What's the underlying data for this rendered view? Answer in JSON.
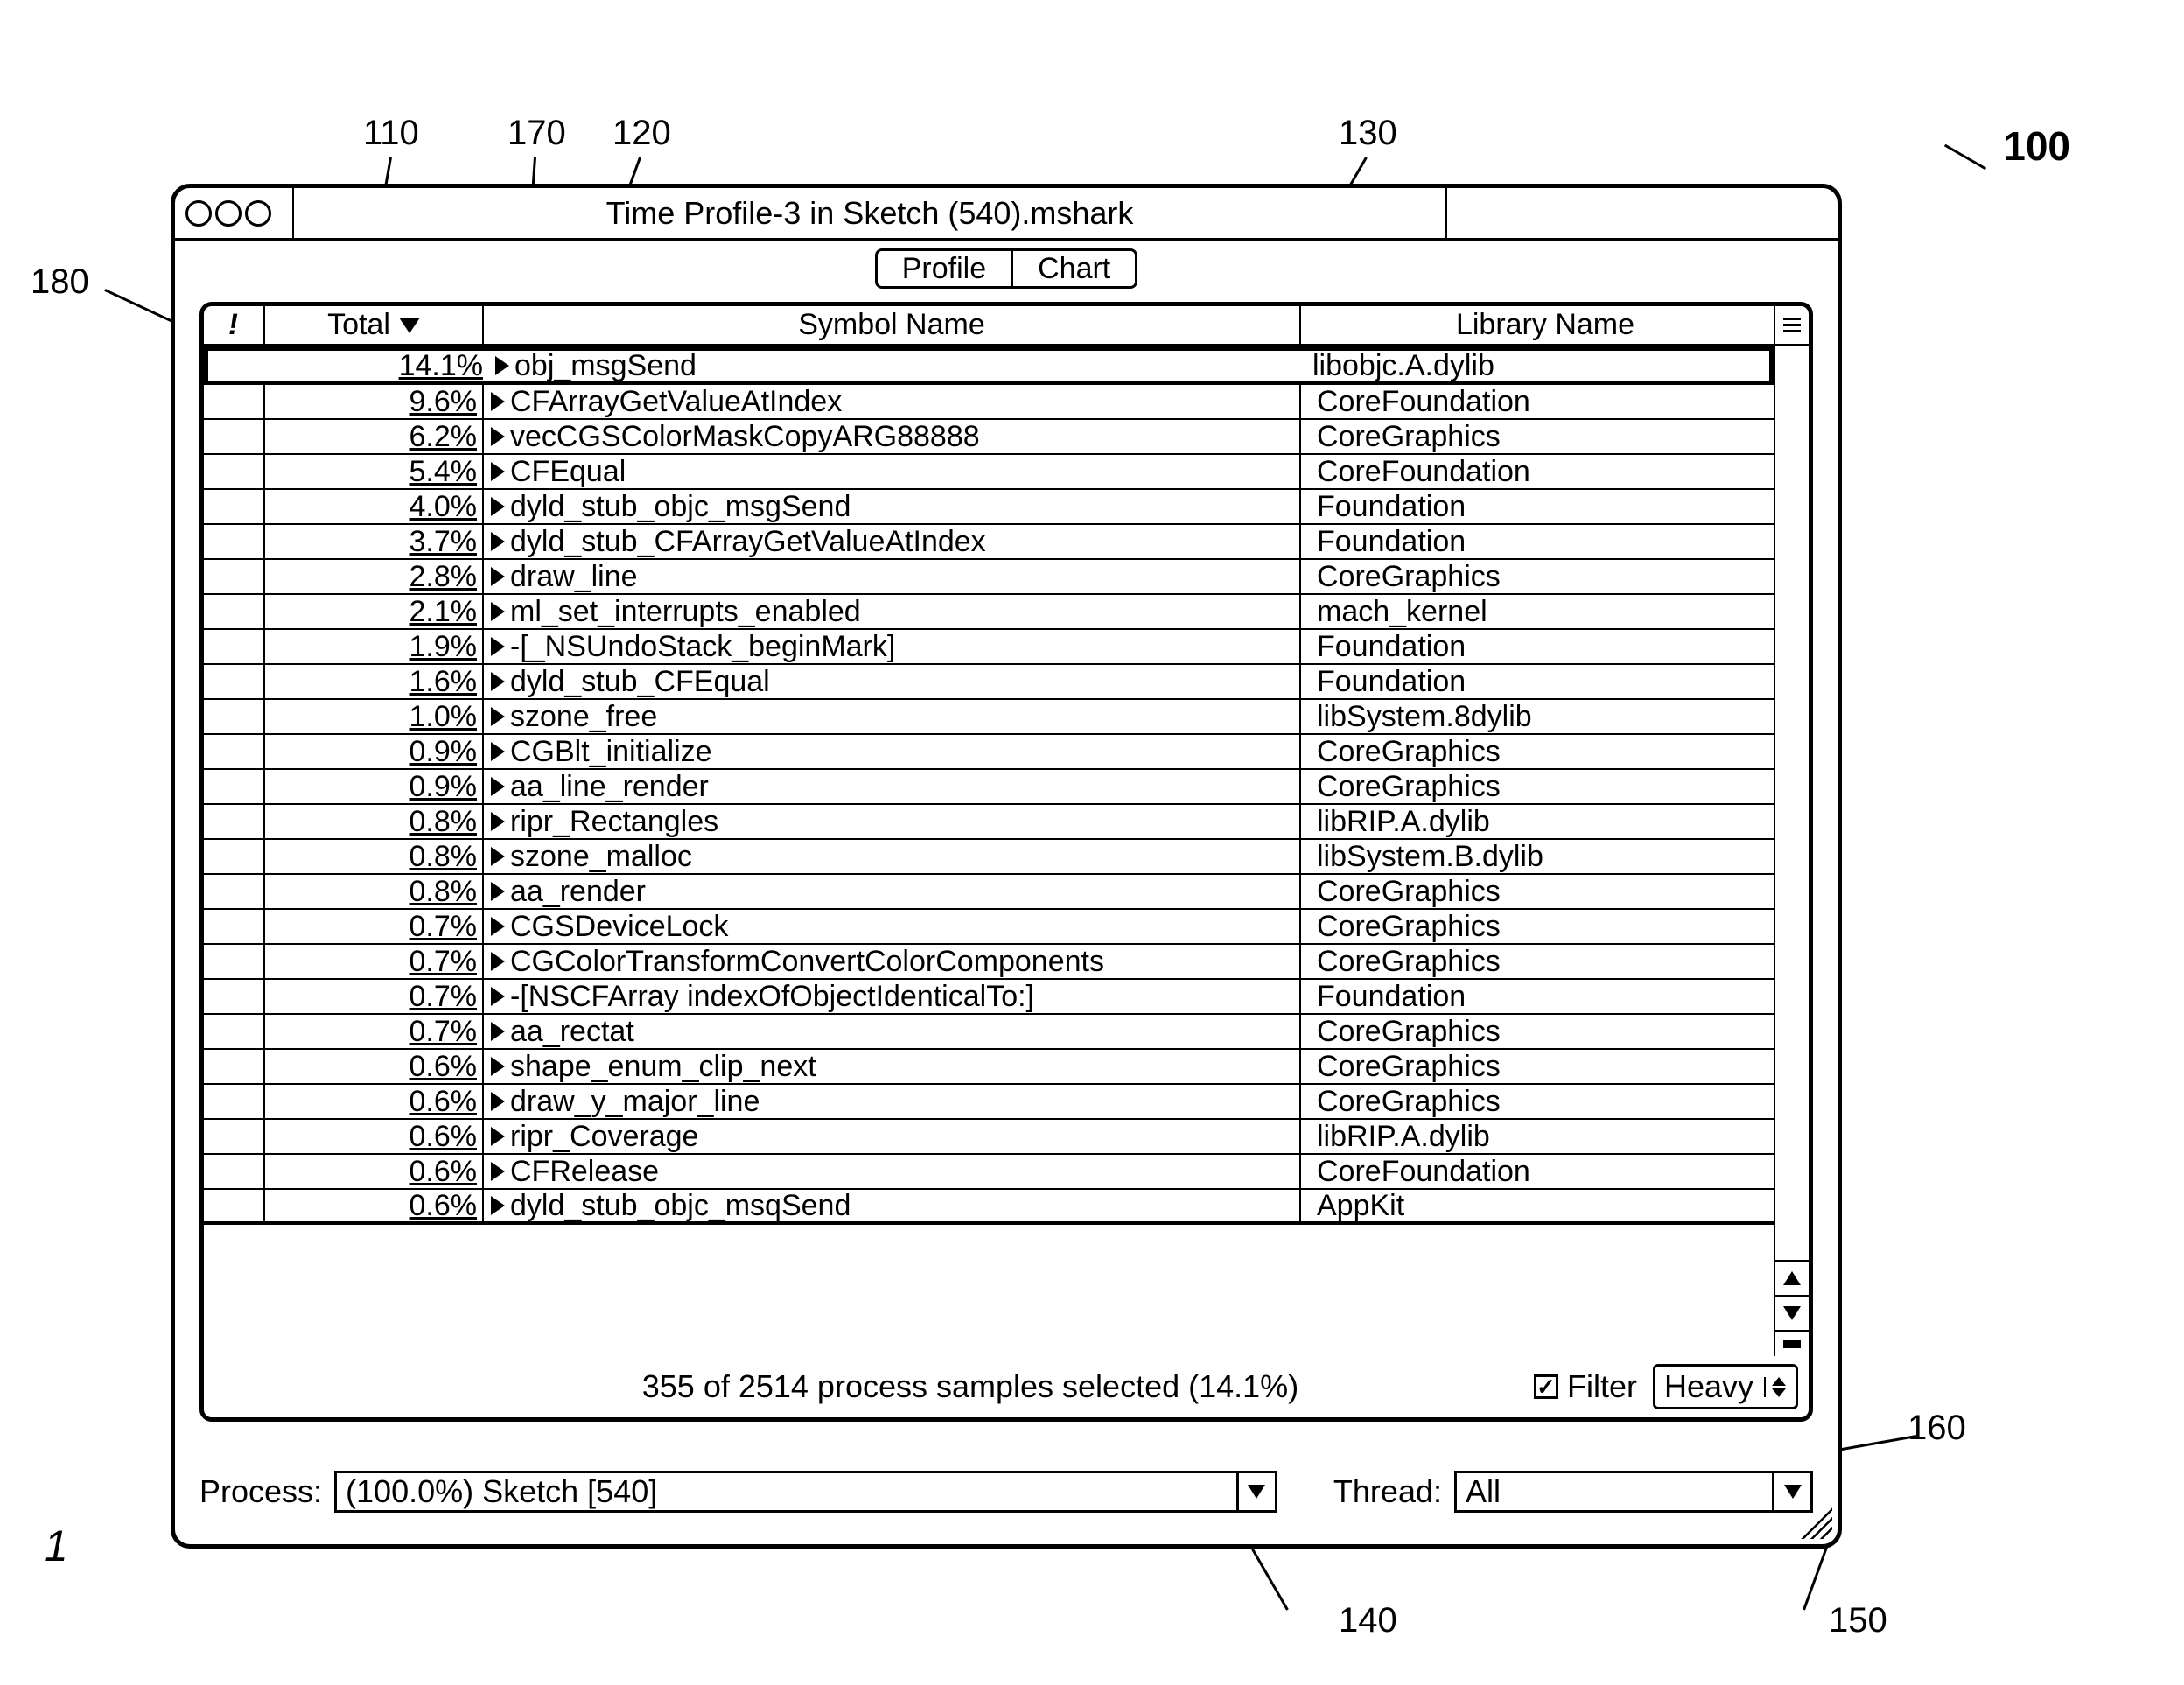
{
  "figure_label": "1",
  "figure_ref": "100",
  "callouts": {
    "c100": "100",
    "c110": "110",
    "c120": "120",
    "c130": "130",
    "c140": "140",
    "c150": "150",
    "c160": "160",
    "c170": "170",
    "c180": "180"
  },
  "window": {
    "title": "Time Profile-3 in Sketch (540).mshark"
  },
  "tabs": {
    "profile": "Profile",
    "chart": "Chart"
  },
  "columns": {
    "alert": "!",
    "total": "Total",
    "symbol": "Symbol Name",
    "library": "Library Name"
  },
  "rows": [
    {
      "total": "14.1%",
      "symbol": "obj_msgSend",
      "lib": "libobjc.A.dylib"
    },
    {
      "total": "9.6%",
      "symbol": "CFArrayGetValueAtIndex",
      "lib": "CoreFoundation"
    },
    {
      "total": "6.2%",
      "symbol": "vecCGSColorMaskCopyARG88888",
      "lib": "CoreGraphics"
    },
    {
      "total": "5.4%",
      "symbol": "CFEqual",
      "lib": "CoreFoundation"
    },
    {
      "total": "4.0%",
      "symbol": "dyld_stub_objc_msgSend",
      "lib": "Foundation"
    },
    {
      "total": "3.7%",
      "symbol": "dyld_stub_CFArrayGetValueAtIndex",
      "lib": "Foundation"
    },
    {
      "total": "2.8%",
      "symbol": "draw_line",
      "lib": "CoreGraphics"
    },
    {
      "total": "2.1%",
      "symbol": "ml_set_interrupts_enabled",
      "lib": "mach_kernel"
    },
    {
      "total": "1.9%",
      "symbol": "-[_NSUndoStack_beginMark]",
      "lib": "Foundation"
    },
    {
      "total": "1.6%",
      "symbol": "dyld_stub_CFEqual",
      "lib": "Foundation"
    },
    {
      "total": "1.0%",
      "symbol": "szone_free",
      "lib": "libSystem.8dylib"
    },
    {
      "total": "0.9%",
      "symbol": "CGBlt_initialize",
      "lib": "CoreGraphics"
    },
    {
      "total": "0.9%",
      "symbol": "aa_line_render",
      "lib": "CoreGraphics"
    },
    {
      "total": "0.8%",
      "symbol": "ripr_Rectangles",
      "lib": "libRIP.A.dylib"
    },
    {
      "total": "0.8%",
      "symbol": "szone_malloc",
      "lib": "libSystem.B.dylib"
    },
    {
      "total": "0.8%",
      "symbol": "aa_render",
      "lib": "CoreGraphics"
    },
    {
      "total": "0.7%",
      "symbol": "CGSDeviceLock",
      "lib": "CoreGraphics"
    },
    {
      "total": "0.7%",
      "symbol": "CGColorTransformConvertColorComponents",
      "lib": "CoreGraphics"
    },
    {
      "total": "0.7%",
      "symbol": "-[NSCFArray indexOfObjectIdenticalTo:]",
      "lib": "Foundation"
    },
    {
      "total": "0.7%",
      "symbol": "aa_rectat",
      "lib": "CoreGraphics"
    },
    {
      "total": "0.6%",
      "symbol": "shape_enum_clip_next",
      "lib": "CoreGraphics"
    },
    {
      "total": "0.6%",
      "symbol": "draw_y_major_line",
      "lib": "CoreGraphics"
    },
    {
      "total": "0.6%",
      "symbol": "ripr_Coverage",
      "lib": "libRIP.A.dylib"
    },
    {
      "total": "0.6%",
      "symbol": " CFRelease",
      "lib": "CoreFoundation"
    },
    {
      "total": "0.6%",
      "symbol": "dyld_stub_objc_msqSend",
      "lib": "AppKit"
    }
  ],
  "status": {
    "text": "355 of 2514 process samples selected (14.1%)",
    "filter_label": "Filter",
    "mode": "Heavy"
  },
  "process": {
    "label": "Process:",
    "value": "(100.0%) Sketch [540]"
  },
  "thread": {
    "label": "Thread:",
    "value": "All"
  }
}
